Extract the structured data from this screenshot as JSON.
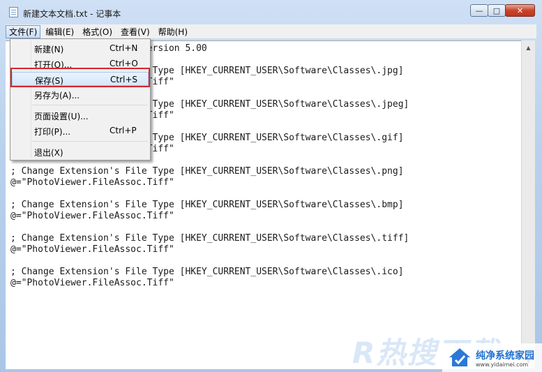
{
  "window": {
    "title": "新建文本文档.txt - 记事本",
    "buttons": {
      "minimize": "—",
      "maximize": "□",
      "close": "✕"
    }
  },
  "menubar": {
    "items": [
      "文件(F)",
      "编辑(E)",
      "格式(O)",
      "查看(V)",
      "帮助(H)"
    ],
    "active": "文件(F)"
  },
  "file_menu": {
    "items": [
      {
        "label": "新建(N)",
        "shortcut": "Ctrl+N"
      },
      {
        "label": "打开(O)...",
        "shortcut": "Ctrl+O"
      },
      {
        "label": "保存(S)",
        "shortcut": "Ctrl+S"
      },
      {
        "label": "另存为(A)...",
        "shortcut": ""
      },
      {
        "label": "页面设置(U)...",
        "shortcut": ""
      },
      {
        "label": "打印(P)...",
        "shortcut": "Ctrl+P"
      },
      {
        "label": "退出(X)",
        "shortcut": ""
      }
    ],
    "highlighted": "保存(S)"
  },
  "editor": {
    "text": "Windows Registry Editor Version 5.00\n\n; Change Extension's File Type [HKEY_CURRENT_USER\\Software\\Classes\\.jpg]\n@=\"PhotoViewer.FileAssoc.Tiff\"\n\n; Change Extension's File Type [HKEY_CURRENT_USER\\Software\\Classes\\.jpeg]\n@=\"PhotoViewer.FileAssoc.Tiff\"\n\n; Change Extension's File Type [HKEY_CURRENT_USER\\Software\\Classes\\.gif]\n@=\"PhotoViewer.FileAssoc.Tiff\"\n\n; Change Extension's File Type [HKEY_CURRENT_USER\\Software\\Classes\\.png]\n@=\"PhotoViewer.FileAssoc.Tiff\"\n\n; Change Extension's File Type [HKEY_CURRENT_USER\\Software\\Classes\\.bmp]\n@=\"PhotoViewer.FileAssoc.Tiff\"\n\n; Change Extension's File Type [HKEY_CURRENT_USER\\Software\\Classes\\.tiff]\n@=\"PhotoViewer.FileAssoc.Tiff\"\n\n; Change Extension's File Type [HKEY_CURRENT_USER\\Software\\Classes\\.ico]\n@=\"PhotoViewer.FileAssoc.Tiff\""
  },
  "scrollbar": {
    "up_arrow": "▲",
    "down_arrow": "▼"
  },
  "watermark": {
    "large_text": "R热搜下载",
    "site_name": "纯净系统家园",
    "site_url": "www.yidaimei.com"
  },
  "colors": {
    "highlight_border": "#d9262c",
    "title_bar": "#b9d1ec",
    "close_button": "#c8442a"
  }
}
